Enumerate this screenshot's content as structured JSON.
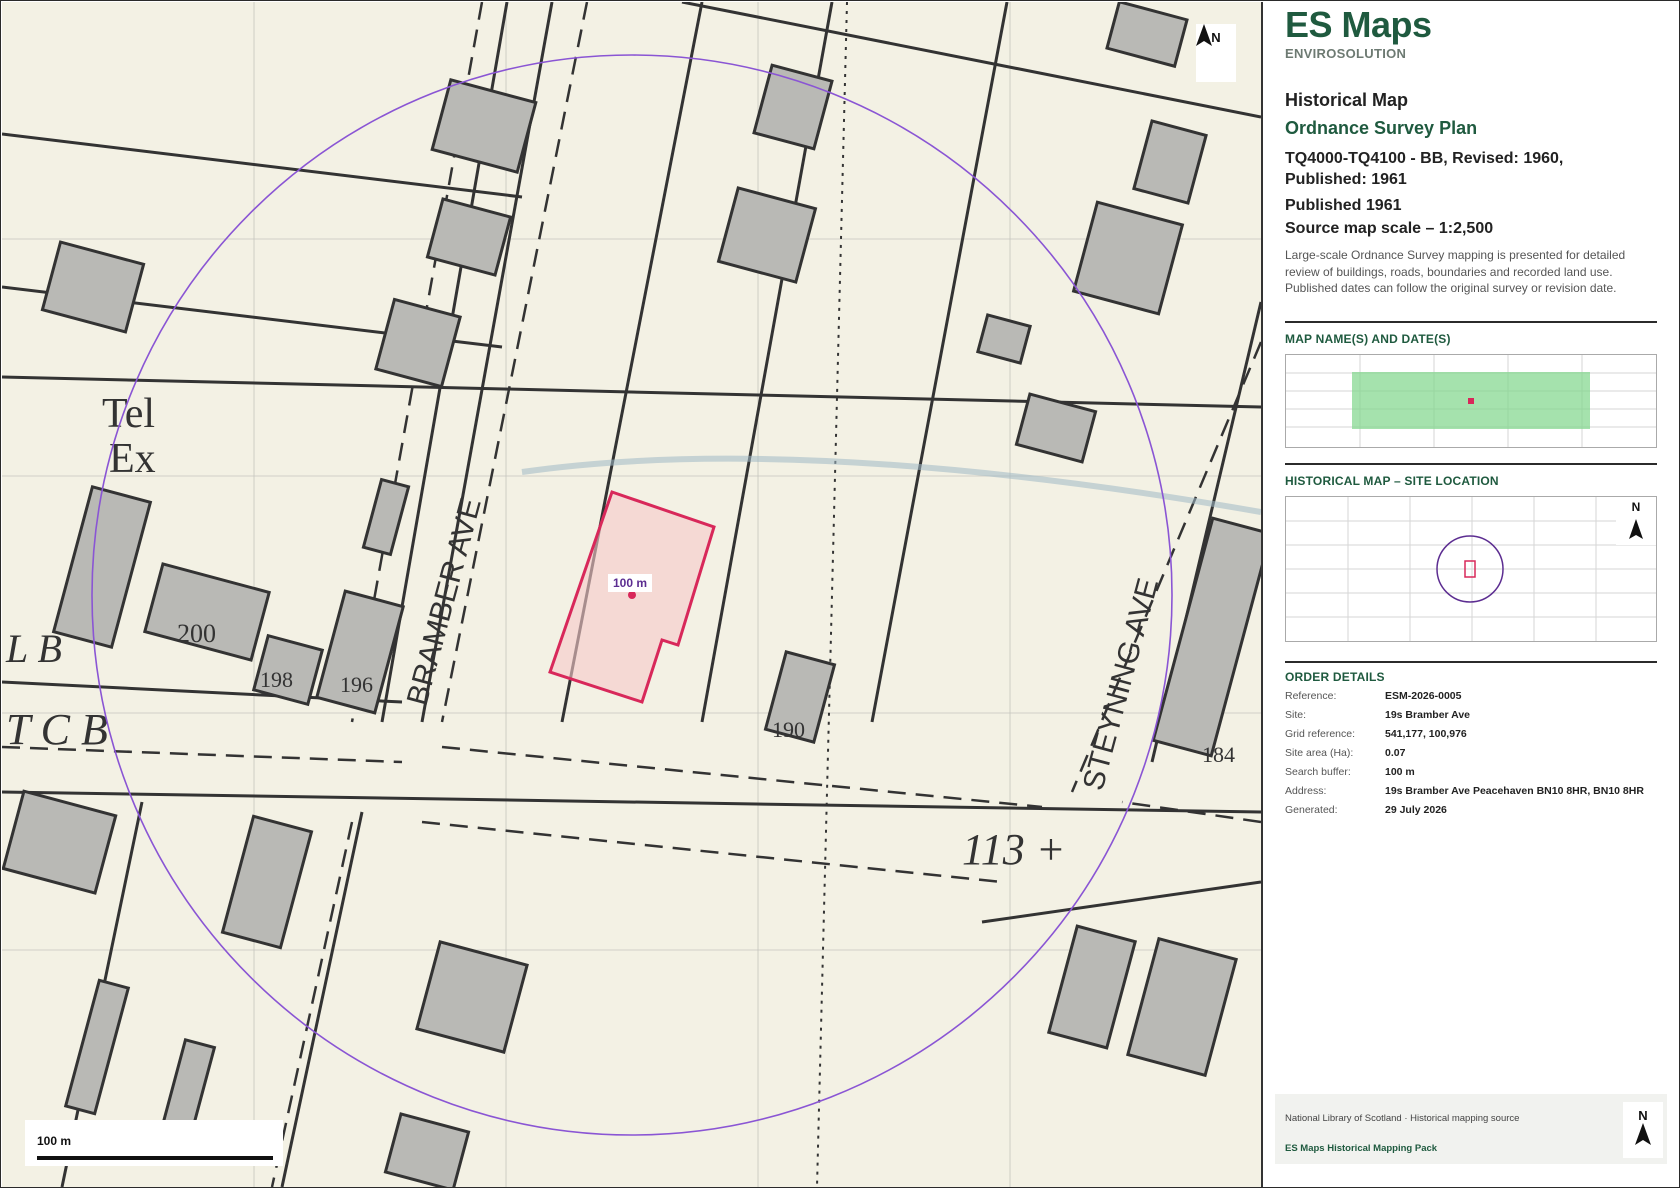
{
  "brand": {
    "name": "ES Maps",
    "subtitle": "ENVIROSOLUTION"
  },
  "map_info": {
    "title": "Historical Map",
    "series": "Ordnance Survey Plan",
    "sheet": "TQ4000-TQ4100 - BB, Revised: 1960, Published: 1961",
    "published": "Published 1961",
    "scale": "Source map scale – 1:2,500",
    "description": "Large-scale Ordnance Survey mapping is presented for detailed review of buildings, roads, boundaries and recorded land use. Published dates can follow the original survey or revision date."
  },
  "sections": {
    "map_names": "MAP NAME(S) AND DATE(S)",
    "site_location": "HISTORICAL MAP – SITE LOCATION",
    "order_details": "ORDER DETAILS"
  },
  "order": [
    {
      "k": "Reference:",
      "v": "ESM-2026-0005"
    },
    {
      "k": "Site:",
      "v": "19s Bramber Ave"
    },
    {
      "k": "Grid reference:",
      "v": "541,177, 100,976"
    },
    {
      "k": "Site area (Ha):",
      "v": "0.07"
    },
    {
      "k": "Search buffer:",
      "v": "100 m"
    },
    {
      "k": "Address:",
      "v": "19s Bramber Ave Peacehaven BN10 8HR, BN10 8HR"
    },
    {
      "k": "Generated:",
      "v": "29 July 2026"
    }
  ],
  "map": {
    "buffer_label": "100 m",
    "scale_bar_label": "100 m",
    "north_label": "N"
  },
  "footer": {
    "source": "National Library of Scotland · Historical mapping source",
    "pack": "ES Maps Historical Mapping Pack"
  },
  "colors": {
    "brand": "#1f5a3f",
    "site_outline": "#d8285a",
    "buffer": "#8a55d4",
    "coverage": "#7fd68a"
  },
  "icons": [
    "north-arrow-icon",
    "scale-bar"
  ]
}
